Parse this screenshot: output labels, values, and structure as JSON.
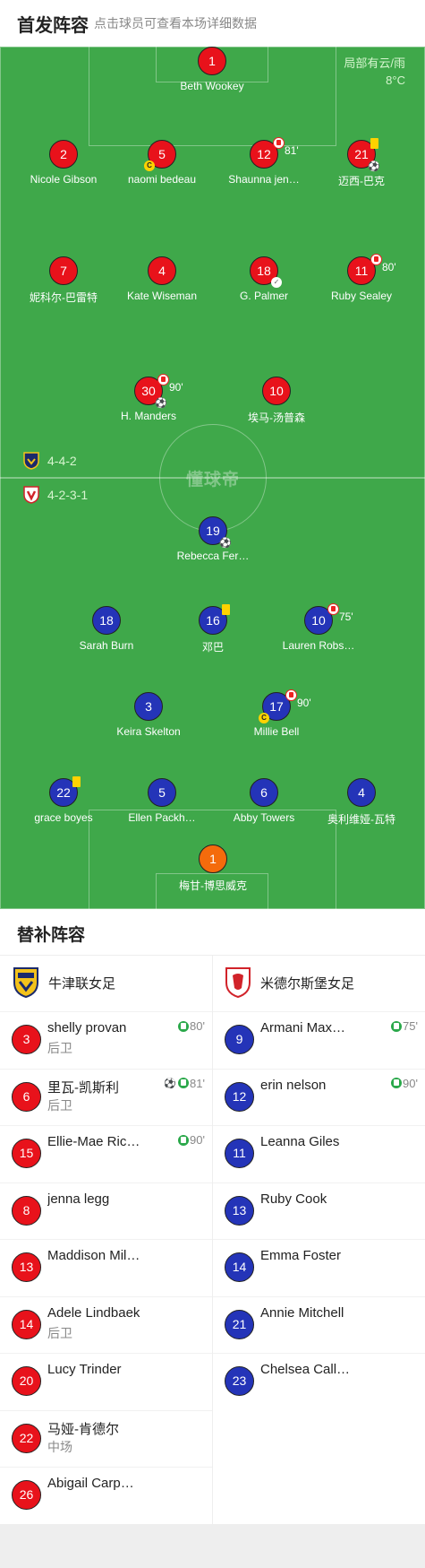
{
  "header": {
    "title": "首发阵容",
    "subtitle": "点击球员可查看本场详细数据"
  },
  "weather": {
    "line1": "局部有云/雨",
    "line2": "8°C"
  },
  "watermark": "懂球帝",
  "formations": {
    "home": "4-4-2",
    "away": "4-2-3-1"
  },
  "home_players": [
    {
      "num": "1",
      "name": "Beth Wookey"
    },
    {
      "num": "2",
      "name": "Nicole Gibson"
    },
    {
      "num": "5",
      "name": "naomi bedeau",
      "captain": true
    },
    {
      "num": "12",
      "name": "Shaunna jen…",
      "sub_min": "81'"
    },
    {
      "num": "21",
      "name": "迈西-巴克",
      "yellow": true,
      "goal": true
    },
    {
      "num": "7",
      "name": "妮科尔-巴雷特"
    },
    {
      "num": "4",
      "name": "Kate Wiseman"
    },
    {
      "num": "18",
      "name": "G. Palmer",
      "boot": true
    },
    {
      "num": "11",
      "name": "Ruby Sealey",
      "sub_min": "80'"
    },
    {
      "num": "30",
      "name": "H. Manders",
      "sub_min": "90'",
      "goal": true
    },
    {
      "num": "10",
      "name": "埃马-汤普森"
    }
  ],
  "away_players": [
    {
      "num": "19",
      "name": "Rebecca Fer…",
      "goal": true
    },
    {
      "num": "18",
      "name": "Sarah Burn"
    },
    {
      "num": "16",
      "name": "邓巴",
      "yellow": true
    },
    {
      "num": "10",
      "name": "Lauren Robs…",
      "sub_min": "75'"
    },
    {
      "num": "3",
      "name": "Keira Skelton"
    },
    {
      "num": "17",
      "name": "Millie Bell",
      "sub_min": "90'",
      "captain": true
    },
    {
      "num": "22",
      "name": "grace boyes",
      "yellow": true
    },
    {
      "num": "5",
      "name": "Ellen Packh…"
    },
    {
      "num": "6",
      "name": "Abby Towers"
    },
    {
      "num": "4",
      "name": "奥利维娅-瓦特"
    },
    {
      "num": "1",
      "name": "梅甘-博思威克",
      "gk": true
    }
  ],
  "bench": {
    "title": "替补阵容",
    "home_team": "牛津联女足",
    "away_team": "米德尔斯堡女足",
    "home": [
      {
        "num": "3",
        "name": "shelly provan",
        "pos": "后卫",
        "in_min": "80'"
      },
      {
        "num": "6",
        "name": "里瓦-凯斯利",
        "pos": "后卫",
        "in_min": "81'",
        "goal": true
      },
      {
        "num": "15",
        "name": "Ellie-Mae Ric…",
        "in_min": "90'"
      },
      {
        "num": "8",
        "name": "jenna legg"
      },
      {
        "num": "13",
        "name": "Maddison Mill…"
      },
      {
        "num": "14",
        "name": "Adele Lindbaek",
        "pos": "后卫"
      },
      {
        "num": "20",
        "name": "Lucy Trinder"
      },
      {
        "num": "22",
        "name": "马娅-肯德尔",
        "pos": "中场"
      },
      {
        "num": "26",
        "name": "Abigail Carpe…"
      }
    ],
    "away": [
      {
        "num": "9",
        "name": "Armani Maxwell",
        "in_min": "75'"
      },
      {
        "num": "12",
        "name": "erin nelson",
        "in_min": "90'"
      },
      {
        "num": "11",
        "name": "Leanna Giles"
      },
      {
        "num": "13",
        "name": "Ruby Cook"
      },
      {
        "num": "14",
        "name": "Emma Foster"
      },
      {
        "num": "21",
        "name": "Annie Mitchell"
      },
      {
        "num": "23",
        "name": "Chelsea Calla…"
      }
    ]
  },
  "colors": {
    "home": "#e8121b",
    "away": "#2434b8",
    "gk_away": "#f46b0c",
    "pitch": "#3fa84a"
  }
}
